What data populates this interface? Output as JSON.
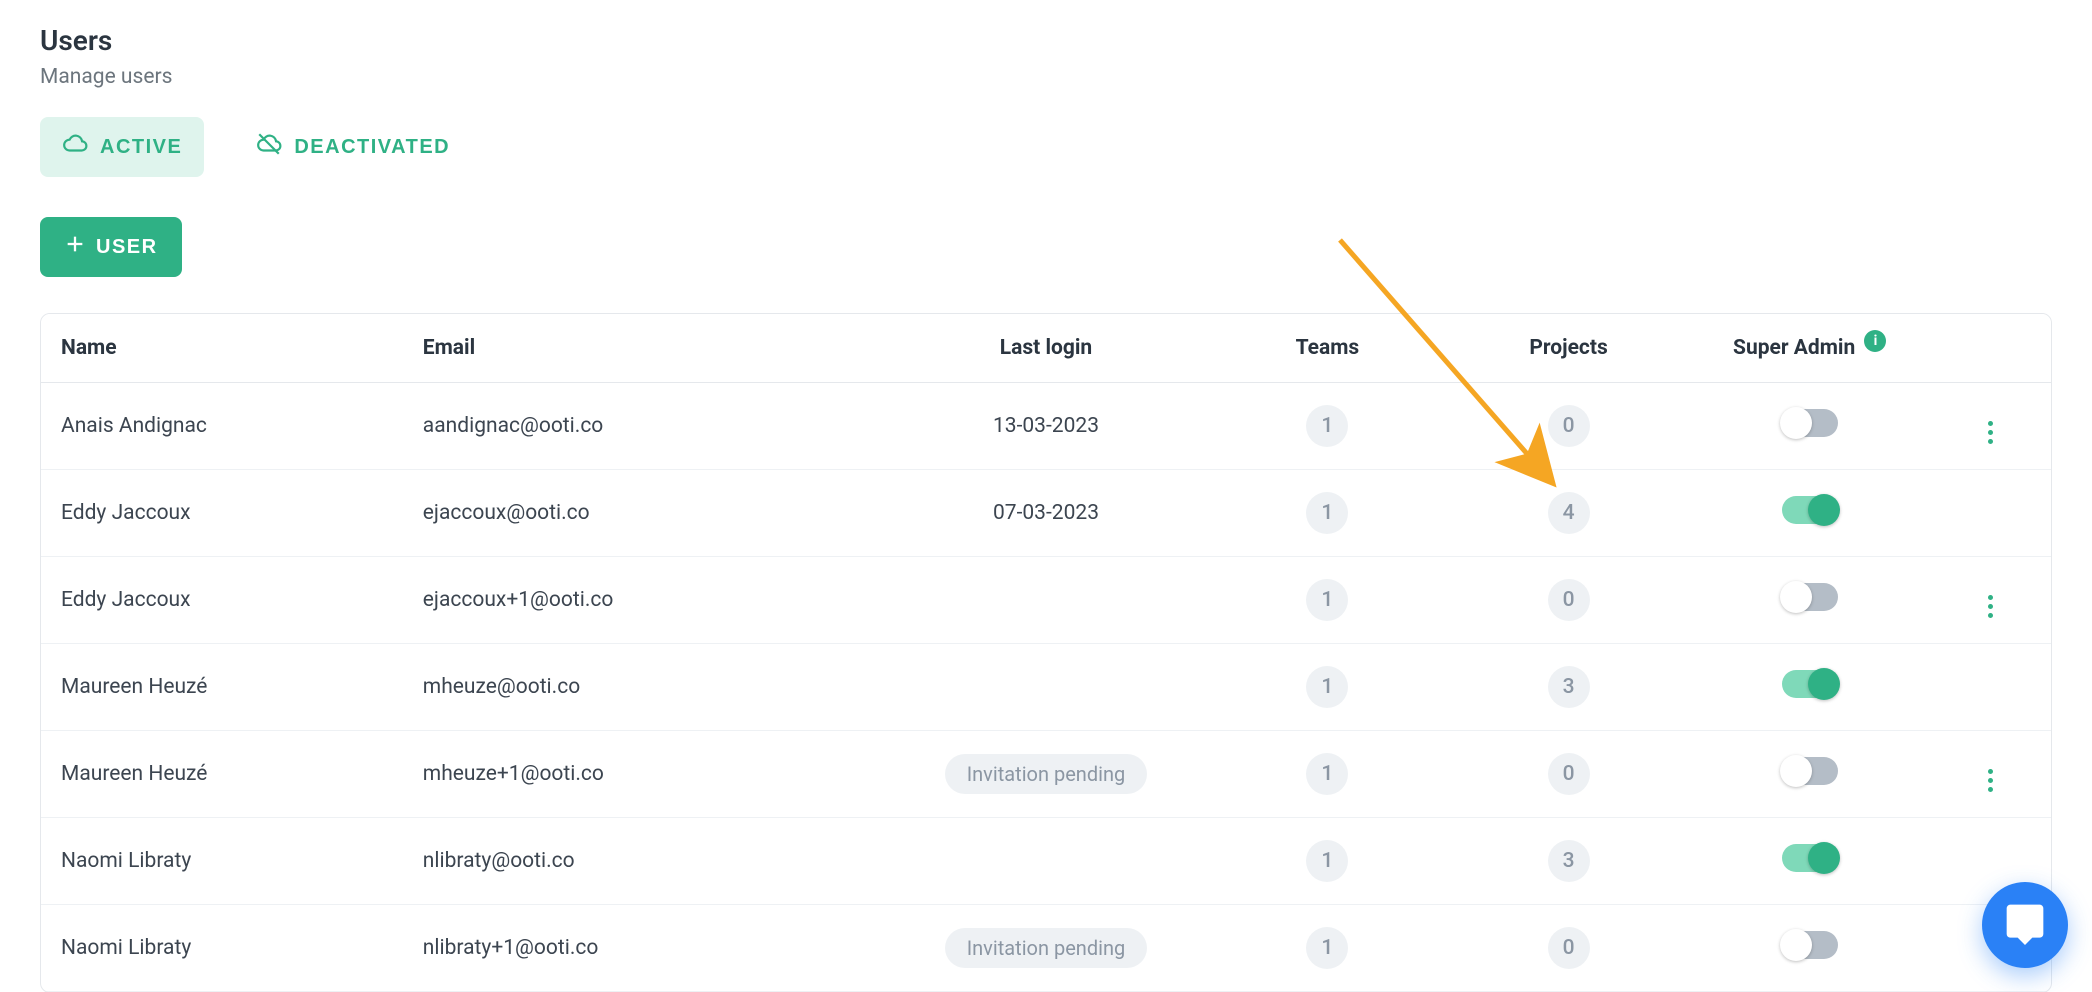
{
  "header": {
    "title": "Users",
    "subtitle": "Manage users"
  },
  "tabs": {
    "active": "ACTIVE",
    "deactivated": "DEACTIVATED"
  },
  "buttons": {
    "add_user": "USER"
  },
  "table": {
    "columns": {
      "name": "Name",
      "email": "Email",
      "last_login": "Last login",
      "teams": "Teams",
      "projects": "Projects",
      "super_admin": "Super Admin"
    },
    "info_badge": "i",
    "rows": [
      {
        "name": "Anais Andignac",
        "email": "aandignac@ooti.co",
        "last_login": "13-03-2023",
        "teams": "1",
        "projects": "0",
        "super_admin": false,
        "has_menu": true
      },
      {
        "name": "Eddy Jaccoux",
        "email": "ejaccoux@ooti.co",
        "last_login": "07-03-2023",
        "teams": "1",
        "projects": "4",
        "super_admin": true,
        "has_menu": false
      },
      {
        "name": "Eddy Jaccoux",
        "email": "ejaccoux+1@ooti.co",
        "last_login": "",
        "teams": "1",
        "projects": "0",
        "super_admin": false,
        "has_menu": true
      },
      {
        "name": "Maureen Heuzé",
        "email": "mheuze@ooti.co",
        "last_login": "",
        "teams": "1",
        "projects": "3",
        "super_admin": true,
        "has_menu": false
      },
      {
        "name": "Maureen Heuzé",
        "email": "mheuze+1@ooti.co",
        "last_login": "Invitation pending",
        "teams": "1",
        "projects": "0",
        "super_admin": false,
        "has_menu": true,
        "pending": true
      },
      {
        "name": "Naomi Libraty",
        "email": "nlibraty@ooti.co",
        "last_login": "",
        "teams": "1",
        "projects": "3",
        "super_admin": true,
        "has_menu": false
      },
      {
        "name": "Naomi Libraty",
        "email": "nlibraty+1@ooti.co",
        "last_login": "Invitation pending",
        "teams": "1",
        "projects": "0",
        "super_admin": false,
        "has_menu": false,
        "pending": true
      }
    ]
  },
  "colors": {
    "accent": "#2fb185",
    "arrow": "#f5a623",
    "chat": "#2a81f6"
  }
}
